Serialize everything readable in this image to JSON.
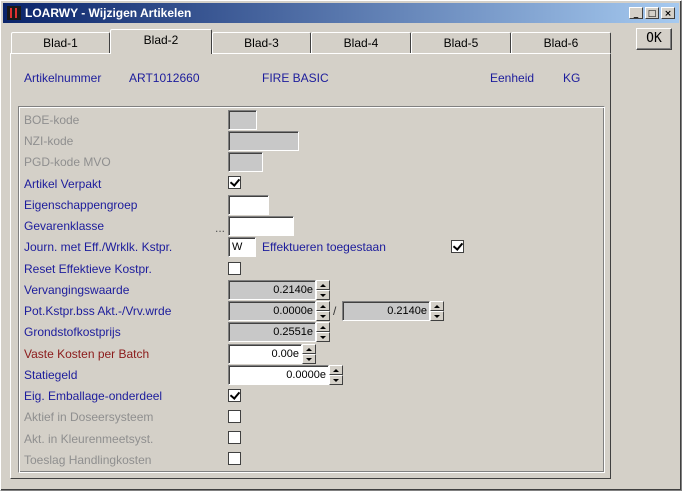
{
  "window": {
    "title": "LOARWY - Wijzigen Artikelen"
  },
  "controls": {
    "minimize": "_",
    "maximize": "□",
    "close": "×"
  },
  "ok_label": "OK",
  "tabs": [
    {
      "label": "Blad-1",
      "active": false
    },
    {
      "label": "Blad-2",
      "active": true
    },
    {
      "label": "Blad-3",
      "active": false
    },
    {
      "label": "Blad-4",
      "active": false
    },
    {
      "label": "Blad-5",
      "active": false
    },
    {
      "label": "Blad-6",
      "active": false
    }
  ],
  "header": {
    "artikelnummer_label": "Artikelnummer",
    "artikelnummer_value": "ART1012660",
    "omschrijving": "FIRE BASIC",
    "eenheid_label": "Eenheid",
    "eenheid_value": "KG"
  },
  "fields": {
    "boe_kode": {
      "label": "BOE-kode",
      "value": ""
    },
    "nzi_kode": {
      "label": "NZI-kode",
      "value": ""
    },
    "pgd_kode": {
      "label": "PGD-kode MVO",
      "value": ""
    },
    "artikel_verpakt": {
      "label": "Artikel Verpakt",
      "checked": true
    },
    "eigenschappengroep": {
      "label": "Eigenschappengroep",
      "value": ""
    },
    "gevarenklasse": {
      "label": "Gevarenklasse",
      "value": "",
      "ellipsis": "..."
    },
    "journ": {
      "label": "Journ. met Eff./Wrklk. Kstpr.",
      "value": "W",
      "effekt_label": "Effektueren toegestaan",
      "effekt_checked": true
    },
    "reset": {
      "label": "Reset Effektieve Kostpr.",
      "checked": false
    },
    "vervangingswaarde": {
      "label": "Vervangingswaarde",
      "value": "0.2140e"
    },
    "pot_kstpr": {
      "label": "Pot.Kstpr.bss Akt.-/Vrv.wrde",
      "value1": "0.0000e",
      "separator": "/",
      "value2": "0.2140e"
    },
    "grondstofkostprijs": {
      "label": "Grondstofkostprijs",
      "value": "0.2551e"
    },
    "vaste_kosten": {
      "label": "Vaste Kosten per Batch",
      "value": "0.00e"
    },
    "statiegeld": {
      "label": "Statiegeld",
      "value": "0.0000e"
    },
    "eig_emballage": {
      "label": "Eig. Emballage-onderdeel",
      "checked": true
    },
    "aktief_doseer": {
      "label": "Aktief in Doseersysteem",
      "checked": false
    },
    "akt_kleuren": {
      "label": "Akt. in Kleurenmeetsyst.",
      "checked": false
    },
    "toeslag": {
      "label": "Toeslag Handlingkosten",
      "checked": false
    }
  }
}
